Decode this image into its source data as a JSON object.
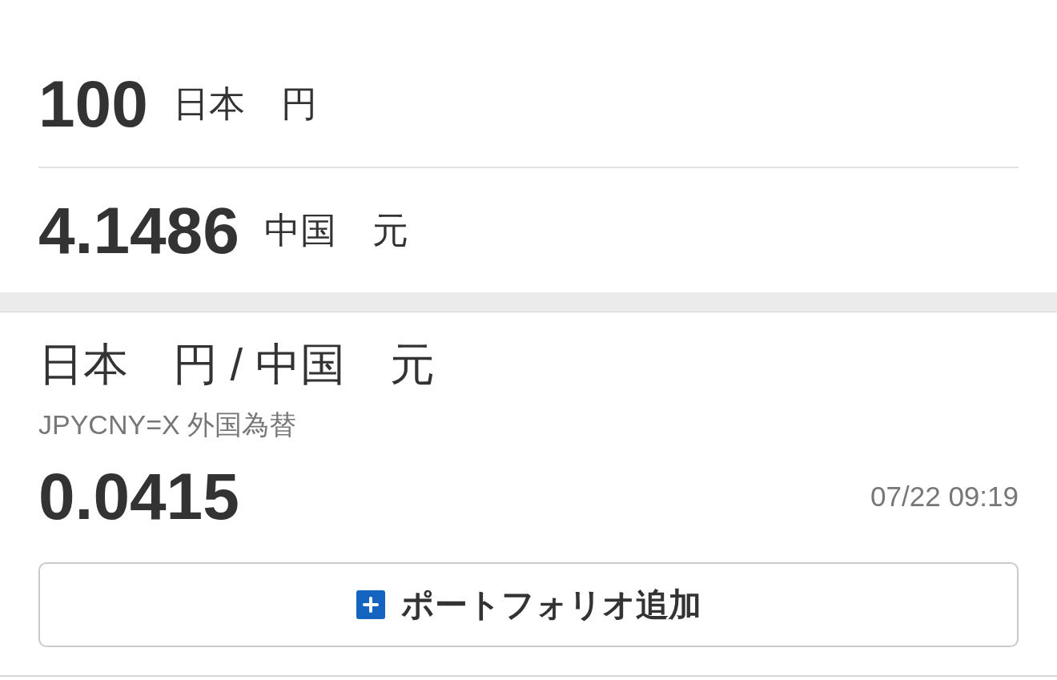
{
  "converter": {
    "rows": [
      {
        "amount": "100",
        "currency": "日本　円"
      },
      {
        "amount": "4.1486",
        "currency": "中国　元"
      }
    ]
  },
  "quote": {
    "title": "日本　円 / 中国　元",
    "symbol": "JPYCNY=X 外国為替",
    "price": "0.0415",
    "timestamp": "07/22 09:19"
  },
  "add_button": {
    "label": "ポートフォリオ追加"
  }
}
